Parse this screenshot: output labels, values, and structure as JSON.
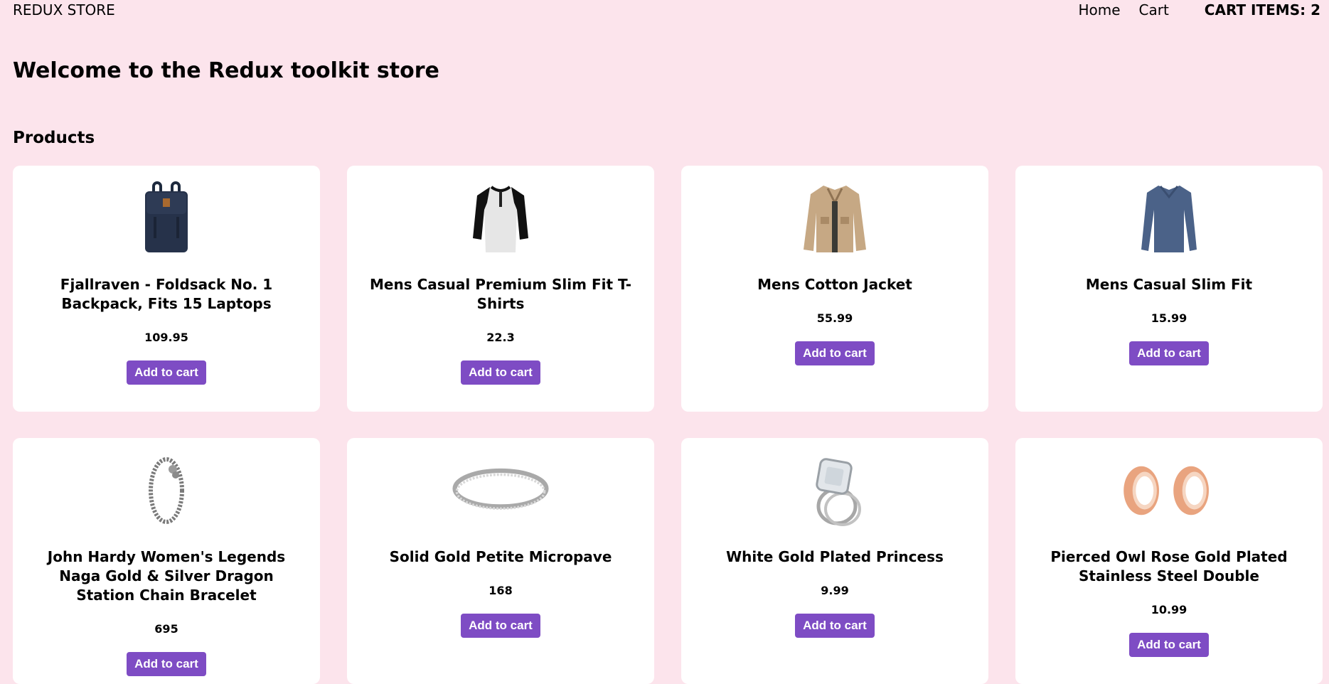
{
  "nav": {
    "brand": "REDUX STORE",
    "home": "Home",
    "cart": "Cart",
    "cart_items": "CART ITEMS: 2"
  },
  "main": {
    "welcome": "Welcome to the Redux toolkit store",
    "products_heading": "Products"
  },
  "products": [
    {
      "title": "Fjallraven - Foldsack No. 1 Backpack, Fits 15 Laptops",
      "price": "109.95",
      "button": "Add to cart",
      "icon": "backpack-icon"
    },
    {
      "title": "Mens Casual Premium Slim Fit T-Shirts",
      "price": "22.3",
      "button": "Add to cart",
      "icon": "tshirt-icon"
    },
    {
      "title": "Mens Cotton Jacket",
      "price": "55.99",
      "button": "Add to cart",
      "icon": "jacket-icon"
    },
    {
      "title": "Mens Casual Slim Fit",
      "price": "15.99",
      "button": "Add to cart",
      "icon": "longsleeve-shirt-icon"
    },
    {
      "title": "John Hardy Women's Legends Naga Gold & Silver Dragon Station Chain Bracelet",
      "price": "695",
      "button": "Add to cart",
      "icon": "bracelet-icon"
    },
    {
      "title": "Solid Gold Petite Micropave",
      "price": "168",
      "button": "Add to cart",
      "icon": "ring-icon"
    },
    {
      "title": "White Gold Plated Princess",
      "price": "9.99",
      "button": "Add to cart",
      "icon": "diamond-ring-icon"
    },
    {
      "title": "Pierced Owl Rose Gold Plated Stainless Steel Double",
      "price": "10.99",
      "button": "Add to cart",
      "icon": "ear-plugs-icon"
    }
  ],
  "colors": {
    "background": "#fce4ec",
    "card": "#ffffff",
    "button": "#7e4cc4"
  }
}
